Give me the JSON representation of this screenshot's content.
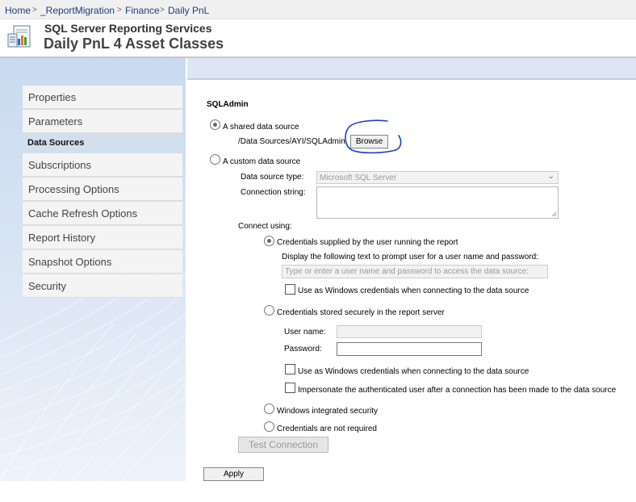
{
  "breadcrumb": {
    "items": [
      "Home",
      "_ReportMigration",
      "Finance",
      "Daily PnL"
    ],
    "separator": ">"
  },
  "header": {
    "product": "SQL Server Reporting Services",
    "title": "Daily PnL 4 Asset Classes",
    "icon": "report-icon"
  },
  "nav": {
    "items": [
      {
        "label": "Properties",
        "selected": false
      },
      {
        "label": "Parameters",
        "selected": false
      },
      {
        "label": "Data Sources",
        "selected": true
      },
      {
        "label": "Subscriptions",
        "selected": false
      },
      {
        "label": "Processing Options",
        "selected": false
      },
      {
        "label": "Cache Refresh Options",
        "selected": false
      },
      {
        "label": "Report History",
        "selected": false
      },
      {
        "label": "Snapshot Options",
        "selected": false
      },
      {
        "label": "Security",
        "selected": false
      }
    ]
  },
  "datasource": {
    "name": "SQLAdmin",
    "shared_label": "A shared data source",
    "shared_path": "/Data Sources/AYI/SQLAdmin",
    "browse_label": "Browse",
    "custom_label": "A custom data source",
    "type_label": "Data source type:",
    "type_value": "Microsoft SQL Server",
    "conn_label": "Connection string:",
    "conn_value": "",
    "connect_using_label": "Connect using:",
    "cred_prompt_label": "Credentials supplied by the user running the report",
    "prompt_text_label": "Display the following text to prompt user for a user name and password:",
    "prompt_text_value": "Type or enter a user name and password to access the data source:",
    "win_creds_label_1": "Use as Windows credentials when connecting to the data source",
    "cred_stored_label": "Credentials stored securely in the report server",
    "username_label": "User name:",
    "username_value": "",
    "password_label": "Password:",
    "password_value": "",
    "win_creds_label_2": "Use as Windows credentials when connecting to the data source",
    "impersonate_label": "Impersonate the authenticated user after a connection has been made to the data source",
    "windows_integrated_label": "Windows integrated security",
    "not_required_label": "Credentials are not required",
    "test_connection_label": "Test Connection",
    "apply_label": "Apply"
  },
  "colors": {
    "annotation_circle": "#1a3fc4",
    "nav_selected": "#d4dfed",
    "breadcrumb_link": "#1a3f7a"
  }
}
